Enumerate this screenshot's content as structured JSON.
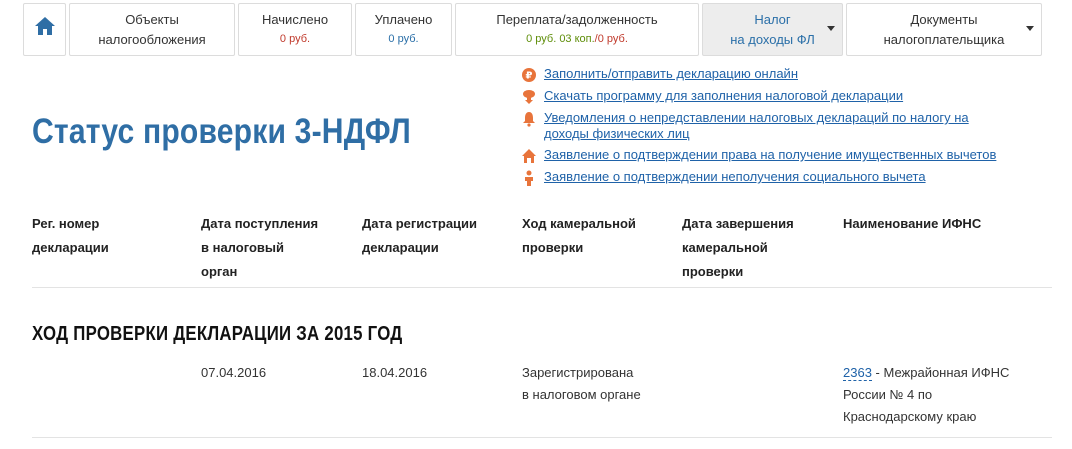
{
  "tabs": [
    {
      "label1": "Объекты",
      "label2": "налогообложения"
    },
    {
      "label1": "Начислено",
      "amount": "0 руб."
    },
    {
      "label1": "Уплачено",
      "amount": "0 руб."
    },
    {
      "label1": "Переплата/задолженность",
      "amount_green": "0 руб. 03 коп.",
      "amount_red": "/0 руб."
    },
    {
      "label1": "Налог",
      "label2": "на доходы ФЛ"
    },
    {
      "label1": "Документы",
      "label2": "налогоплательщика"
    }
  ],
  "title": "Статус проверки 3-НДФЛ",
  "links": [
    {
      "text": "Заполнить/отправить декларацию онлайн",
      "icon": "ruble-circle-icon"
    },
    {
      "text": "Скачать программу для заполнения налоговой декларации",
      "icon": "download-icon"
    },
    {
      "text1": "Уведомления о непредставлении налоговых деклараций по налогу на",
      "text2": "доходы физических лиц",
      "icon": "bell-icon"
    },
    {
      "text": "Заявление о подтверждении права на получение имущественных вычетов",
      "icon": "house-icon"
    },
    {
      "text": "Заявление о подтверждении неполучения социального вычета",
      "icon": "person-icon"
    }
  ],
  "table": {
    "headers": [
      {
        "l1": "Рег. номер",
        "l2": "декларации"
      },
      {
        "l1": "Дата поступления",
        "l2": "в налоговый",
        "l3": "орган"
      },
      {
        "l1": "Дата регистрации",
        "l2": "декларации"
      },
      {
        "l1": "Ход камеральной",
        "l2": "проверки"
      },
      {
        "l1": "Дата завершения",
        "l2": "камеральной",
        "l3": "проверки"
      },
      {
        "l1": "Наименование ИФНС"
      }
    ],
    "section_title": "ХОД ПРОВЕРКИ ДЕКЛАРАЦИИ ЗА 2015 ГОД",
    "row": {
      "date_received": "07.04.2016",
      "date_registered": "18.04.2016",
      "status1": "Зарегистрирована",
      "status2": "в налоговом органе",
      "ifns_code": "2363",
      "ifns1": " - Межрайонная ИФНС",
      "ifns2": "России № 4 по",
      "ifns3": "Краснодарскому краю"
    }
  },
  "colors": {
    "accent": "#2f6ea5",
    "link": "#1f62a8",
    "icon_orange": "#e8743b",
    "green": "#5f8e0a"
  }
}
